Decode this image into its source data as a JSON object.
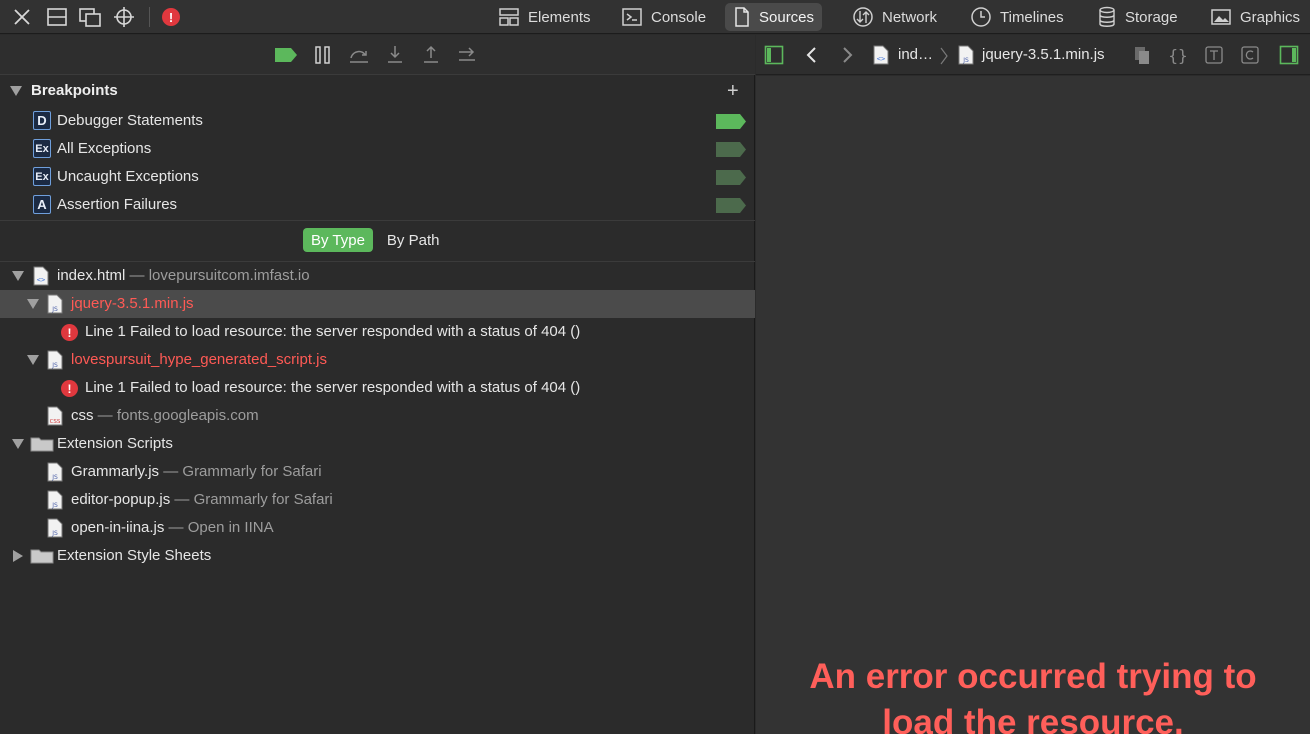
{
  "toolbar": {
    "tabs": [
      {
        "label": "Elements",
        "icon": "elements-icon"
      },
      {
        "label": "Console",
        "icon": "console-icon"
      },
      {
        "label": "Sources",
        "icon": "sources-icon",
        "active": true
      },
      {
        "label": "Network",
        "icon": "network-icon"
      },
      {
        "label": "Timelines",
        "icon": "timelines-icon"
      },
      {
        "label": "Storage",
        "icon": "storage-icon"
      },
      {
        "label": "Graphics",
        "icon": "graphics-icon"
      }
    ],
    "error_badge": "!"
  },
  "debugger": {
    "breakpoints": {
      "title": "Breakpoints",
      "add": "+",
      "items": [
        {
          "badge": "D",
          "label": "Debugger Statements",
          "enabled": true
        },
        {
          "badge": "Ex",
          "label": "All Exceptions",
          "enabled": false
        },
        {
          "badge": "Ex",
          "label": "Uncaught Exceptions",
          "enabled": false
        },
        {
          "badge": "A",
          "label": "Assertion Failures",
          "enabled": false
        }
      ]
    },
    "grouping": {
      "by_type": "By Type",
      "by_path": "By Path"
    }
  },
  "tree": {
    "index": {
      "name": "index.html",
      "sub": " — lovepursuitcom.imfast.io"
    },
    "jquery": {
      "name": "jquery-3.5.1.min.js"
    },
    "jquery_error": "Line 1 Failed to load resource: the server responded with a status of 404 ()",
    "hype": {
      "name": "lovespursuit_hype_generated_script.js"
    },
    "hype_error": "Line 1 Failed to load resource: the server responded with a status of 404 ()",
    "css": {
      "name": "css",
      "sub": " — fonts.googleapis.com"
    },
    "ext_scripts": "Extension Scripts",
    "grammarly": {
      "name": "Grammarly.js",
      "sub": " — Grammarly for Safari"
    },
    "editor_popup": {
      "name": "editor-popup.js",
      "sub": " — Grammarly for Safari"
    },
    "open_iina": {
      "name": "open-in-iina.js",
      "sub": " — Open in IINA"
    },
    "ext_styles": "Extension Style Sheets"
  },
  "file_icons": {
    "html": "<>",
    "js": "JS",
    "css": "CSS"
  },
  "viewer": {
    "crumb_index": "ind…",
    "crumb_file": "jquery-3.5.1.min.js",
    "error_line1": "An error occurred trying to",
    "error_line2": "load the resource."
  },
  "colors": {
    "accent_green": "#5cb85c",
    "error_red": "#ff5f5a"
  }
}
